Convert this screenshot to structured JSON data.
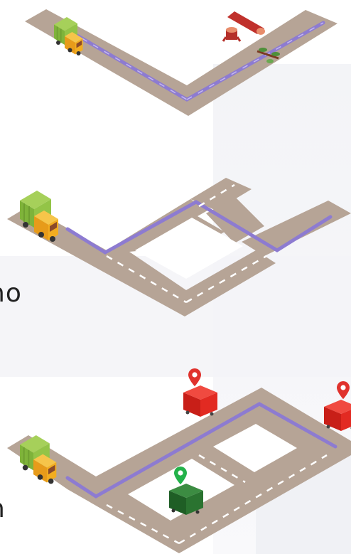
{
  "left_edge_text": {
    "line1": "no",
    "line2": "n"
  },
  "colors": {
    "road": "#b6a496",
    "road_edge": "#a39283",
    "route": "#8d7bd1",
    "lane_dash": "#ffffff",
    "bin_red": "#e5271f",
    "bin_green": "#2f7a35",
    "pin_red": "#e0322d",
    "pin_green": "#23b24a",
    "truck_body": "#8cc141",
    "truck_cab": "#f4b324"
  },
  "icons": [
    "garbage-truck-icon",
    "log-obstacle-icon",
    "tree-stump-icon",
    "branch-obstacle-icon",
    "red-dumpster-icon",
    "green-dumpster-icon",
    "map-pin-icon"
  ]
}
